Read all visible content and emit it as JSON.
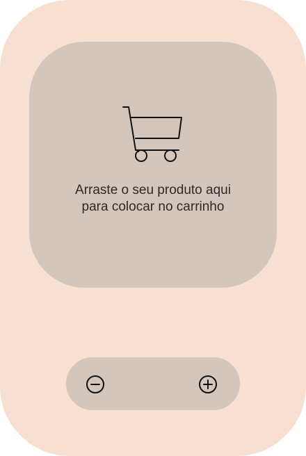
{
  "dropzone": {
    "icon": "shopping-cart-icon",
    "text": "Arraste o seu produto aqui para colocar no carrinho"
  },
  "quantity_control": {
    "decrease_icon": "minus-circle-icon",
    "increase_icon": "plus-circle-icon"
  },
  "colors": {
    "background": "#f7e0d1",
    "panel": "#d3c6bd",
    "text": "#2e2a27",
    "icon": "#111111"
  }
}
